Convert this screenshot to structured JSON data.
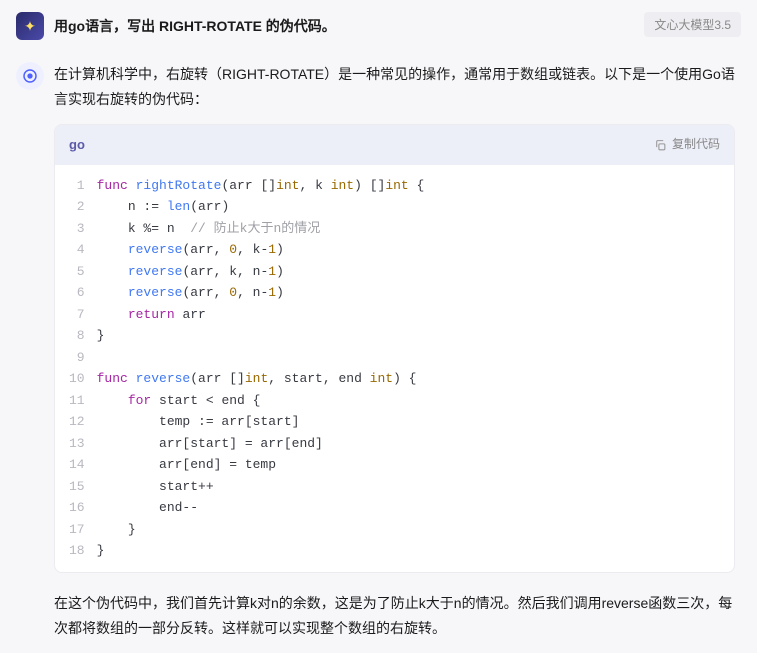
{
  "header": {
    "prompt": "用go语言，写出 RIGHT-ROTATE 的伪代码。",
    "model_badge": "文心大模型3.5"
  },
  "assistant": {
    "intro": "在计算机科学中，右旋转（RIGHT-ROTATE）是一种常见的操作，通常用于数组或链表。以下是一个使用Go语言实现右旋转的伪代码：",
    "outro": "在这个伪代码中，我们首先计算k对n的余数，这是为了防止k大于n的情况。然后我们调用reverse函数三次，每次都将数组的一部分反转。这样就可以实现整个数组的右旋转。"
  },
  "code": {
    "lang": "go",
    "copy_label": "复制代码",
    "line_count": 18,
    "tokens": [
      [
        [
          "kw",
          "func "
        ],
        [
          "fn",
          "rightRotate"
        ],
        [
          "ident",
          "(arr []"
        ],
        [
          "typ",
          "int"
        ],
        [
          "ident",
          ", k "
        ],
        [
          "typ",
          "int"
        ],
        [
          "ident",
          ") []"
        ],
        [
          "typ",
          "int"
        ],
        [
          "ident",
          " {"
        ]
      ],
      [
        [
          "ident",
          "    n := "
        ],
        [
          "fn",
          "len"
        ],
        [
          "ident",
          "(arr)"
        ]
      ],
      [
        [
          "ident",
          "    k %= n  "
        ],
        [
          "cmt",
          "// 防止k大于n的情况"
        ]
      ],
      [
        [
          "ident",
          "    "
        ],
        [
          "fn",
          "reverse"
        ],
        [
          "ident",
          "(arr, "
        ],
        [
          "num",
          "0"
        ],
        [
          "ident",
          ", k-"
        ],
        [
          "num",
          "1"
        ],
        [
          "ident",
          ")"
        ]
      ],
      [
        [
          "ident",
          "    "
        ],
        [
          "fn",
          "reverse"
        ],
        [
          "ident",
          "(arr, k, n-"
        ],
        [
          "num",
          "1"
        ],
        [
          "ident",
          ")"
        ]
      ],
      [
        [
          "ident",
          "    "
        ],
        [
          "fn",
          "reverse"
        ],
        [
          "ident",
          "(arr, "
        ],
        [
          "num",
          "0"
        ],
        [
          "ident",
          ", n-"
        ],
        [
          "num",
          "1"
        ],
        [
          "ident",
          ")"
        ]
      ],
      [
        [
          "ident",
          "    "
        ],
        [
          "kw",
          "return"
        ],
        [
          "ident",
          " arr"
        ]
      ],
      [
        [
          "ident",
          "}"
        ]
      ],
      [
        [
          "ident",
          ""
        ]
      ],
      [
        [
          "kw",
          "func "
        ],
        [
          "fn",
          "reverse"
        ],
        [
          "ident",
          "(arr []"
        ],
        [
          "typ",
          "int"
        ],
        [
          "ident",
          ", start, end "
        ],
        [
          "typ",
          "int"
        ],
        [
          "ident",
          ") {"
        ]
      ],
      [
        [
          "ident",
          "    "
        ],
        [
          "kw",
          "for"
        ],
        [
          "ident",
          " start < end {"
        ]
      ],
      [
        [
          "ident",
          "        temp := arr[start]"
        ]
      ],
      [
        [
          "ident",
          "        arr[start] = arr[end]"
        ]
      ],
      [
        [
          "ident",
          "        arr[end] = temp"
        ]
      ],
      [
        [
          "ident",
          "        start++"
        ]
      ],
      [
        [
          "ident",
          "        end--"
        ]
      ],
      [
        [
          "ident",
          "    }"
        ]
      ],
      [
        [
          "ident",
          "}"
        ]
      ]
    ]
  }
}
